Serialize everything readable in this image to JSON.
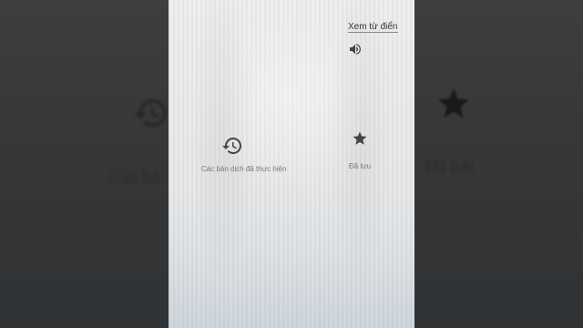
{
  "dictionary": {
    "view_link": "Xem từ điển",
    "speaker_icon": "volume-icon"
  },
  "actions": {
    "history": {
      "label": "Các bản dịch đã thực hiện",
      "icon": "history-icon"
    },
    "saved": {
      "label": "Đã lưu",
      "icon": "star-icon"
    }
  },
  "background": {
    "left_text": "Các bả",
    "right_text": "Đã lưu"
  },
  "colors": {
    "screen": "#e9e9e9",
    "outer": "#3a3a3a",
    "icon": "#444444"
  }
}
